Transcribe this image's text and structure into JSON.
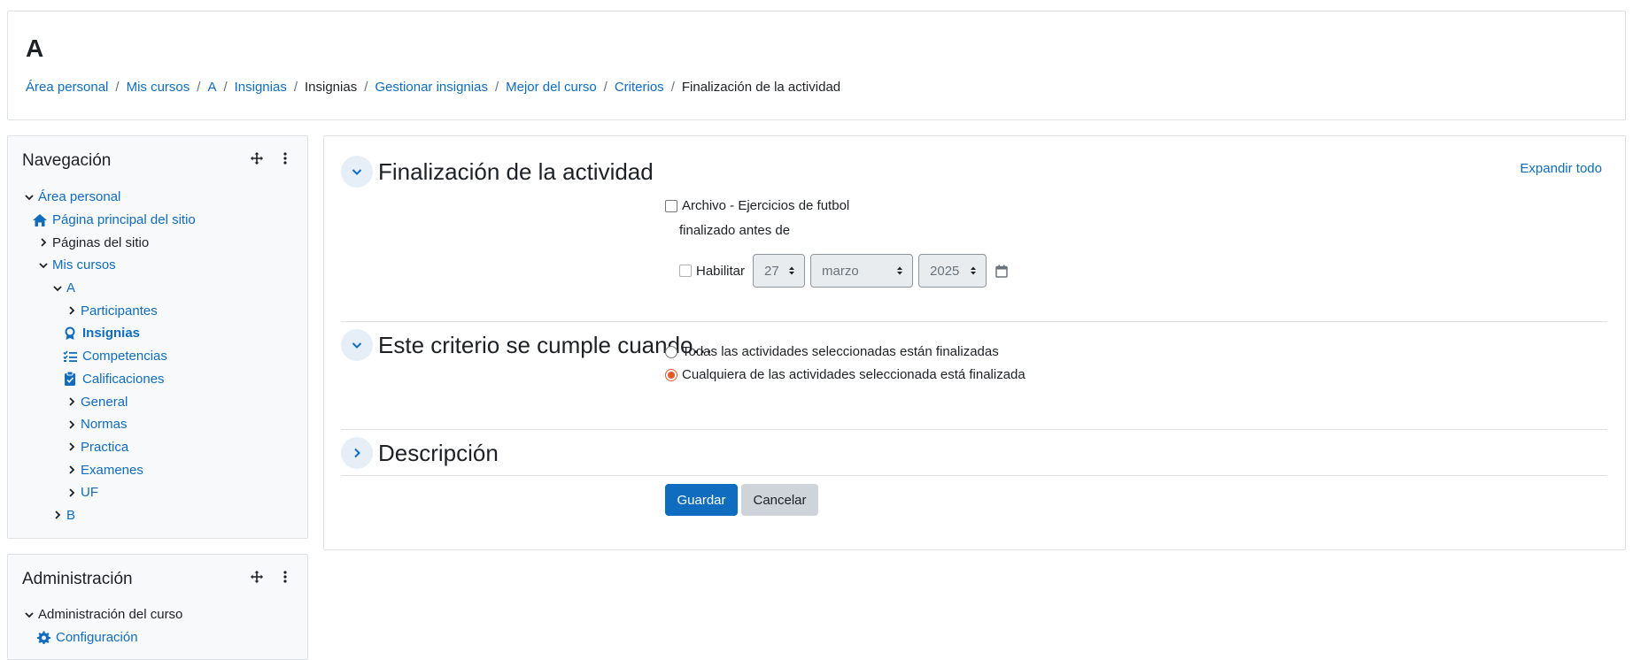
{
  "header": {
    "title": "A",
    "breadcrumb": [
      {
        "label": "Área personal",
        "link": true
      },
      {
        "label": "Mis cursos",
        "link": true
      },
      {
        "label": "A",
        "link": true
      },
      {
        "label": "Insignias",
        "link": true
      },
      {
        "label": "Insignias",
        "link": false
      },
      {
        "label": "Gestionar insignias",
        "link": true
      },
      {
        "label": "Mejor del curso",
        "link": true
      },
      {
        "label": "Criterios",
        "link": true
      },
      {
        "label": "Finalización de la actividad",
        "link": false
      }
    ]
  },
  "navigation": {
    "title": "Navegación",
    "items": [
      {
        "label": "Área personal",
        "icon": "chevron-down-icon"
      },
      {
        "label": "Página principal del sitio",
        "icon": "home-icon"
      },
      {
        "label": "Páginas del sitio",
        "icon": "chevron-right-icon"
      },
      {
        "label": "Mis cursos",
        "icon": "chevron-down-icon"
      },
      {
        "label": "A",
        "icon": "chevron-down-icon"
      },
      {
        "label": "Participantes",
        "icon": "chevron-right-icon"
      },
      {
        "label": "Insignias",
        "icon": "badge-icon"
      },
      {
        "label": "Competencias",
        "icon": "checklist-icon"
      },
      {
        "label": "Calificaciones",
        "icon": "clipboard-icon"
      },
      {
        "label": "General",
        "icon": "chevron-right-icon"
      },
      {
        "label": "Normas",
        "icon": "chevron-right-icon"
      },
      {
        "label": "Practica",
        "icon": "chevron-right-icon"
      },
      {
        "label": "Examenes",
        "icon": "chevron-right-icon"
      },
      {
        "label": "UF",
        "icon": "chevron-right-icon"
      },
      {
        "label": "B",
        "icon": "chevron-right-icon"
      }
    ]
  },
  "administration": {
    "title": "Administración",
    "items": [
      {
        "label": "Administración del curso",
        "icon": "chevron-down-icon"
      },
      {
        "label": "Configuración",
        "icon": "gear-icon"
      }
    ]
  },
  "main": {
    "expand_all": "Expandir todo",
    "section1": {
      "title": "Finalización de la actividad",
      "activity_label": "Archivo - Ejercicios de futbol",
      "completed_before": "finalizado antes de",
      "enable_label": "Habilitar",
      "day": "27",
      "month": "marzo",
      "year": "2025"
    },
    "section2": {
      "title": "Este criterio se cumple cuando...",
      "option_all": "Todas las actividades seleccionadas están finalizadas",
      "option_any": "Cualquiera de las actividades seleccionada está finalizada",
      "selected": "any"
    },
    "section3": {
      "title": "Descripción"
    },
    "save_label": "Guardar",
    "cancel_label": "Cancelar"
  },
  "colors": {
    "link": "#0f6cbf",
    "primary_button": "#0f6cbf",
    "radio_selected": "#e25a2c"
  }
}
